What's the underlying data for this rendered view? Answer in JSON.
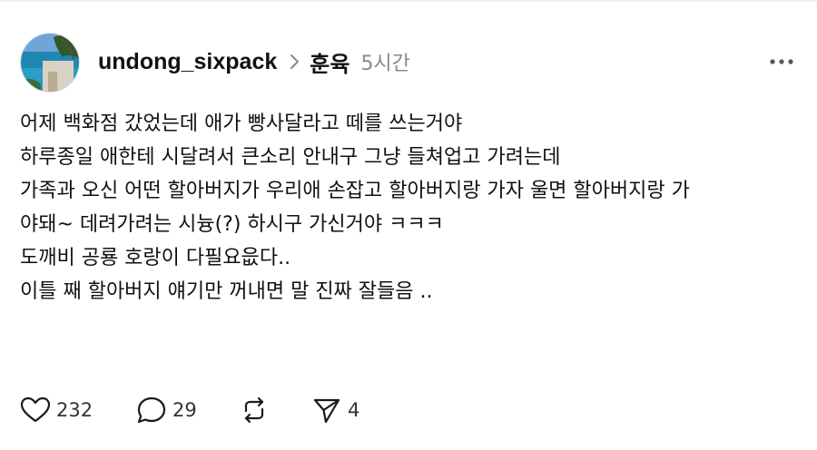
{
  "post": {
    "author": "undong_sixpack",
    "topic": "훈육",
    "time": "5시간",
    "avatar_icon": "avatar-beach-photo",
    "lines": [
      "어제 백화점 갔었는데 애가 빵사달라고 떼를 쓰는거야",
      "하루종일 애한테 시달려서 큰소리 안내구 그냥 들쳐업고 가려는데",
      "가족과 오신 어떤 할아버지가 우리애 손잡고 할아버지랑 가자 울면 할아버지랑 가",
      "야돼~ 데려가려는 시늉(?) 하시구 가신거야 ㅋㅋㅋ",
      "도깨비 공룡 호랑이 다필요읎다..",
      "이틀 째 할아버지 얘기만 꺼내면 말 진짜 잘들음 .."
    ]
  },
  "actions": {
    "like_count": "232",
    "reply_count": "29",
    "share_count": "4",
    "icons": [
      "heart-icon",
      "comment-icon",
      "repost-icon",
      "share-icon",
      "more-icon",
      "chevron-right-icon"
    ]
  },
  "colors": {
    "text": "#111111",
    "muted": "#8a8a8a",
    "icon": "#1a1a1a"
  }
}
